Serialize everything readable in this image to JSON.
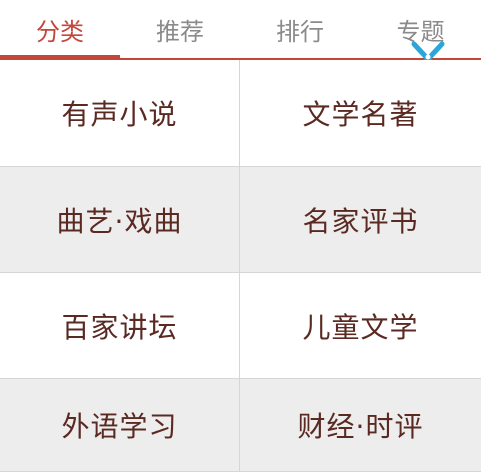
{
  "tabs": [
    {
      "label": "分类",
      "active": true
    },
    {
      "label": "推荐",
      "active": false
    },
    {
      "label": "排行",
      "active": false
    },
    {
      "label": "专题",
      "active": false
    }
  ],
  "categories": [
    {
      "label": "有声小说"
    },
    {
      "label": "文学名著"
    },
    {
      "label": "曲艺·戏曲"
    },
    {
      "label": "名家评书"
    },
    {
      "label": "百家讲坛"
    },
    {
      "label": "儿童文学"
    },
    {
      "label": "外语学习"
    },
    {
      "label": "财经·时评"
    }
  ],
  "colors": {
    "accent": "#c4463a",
    "tab_inactive": "#8a8a8a",
    "cell_text": "#5a2a22",
    "row_alt_bg": "#ededed",
    "divider": "#d6d6d6",
    "scissors_icon": "#2aa6d8"
  },
  "icons": {
    "scissors": "scissors-icon"
  }
}
